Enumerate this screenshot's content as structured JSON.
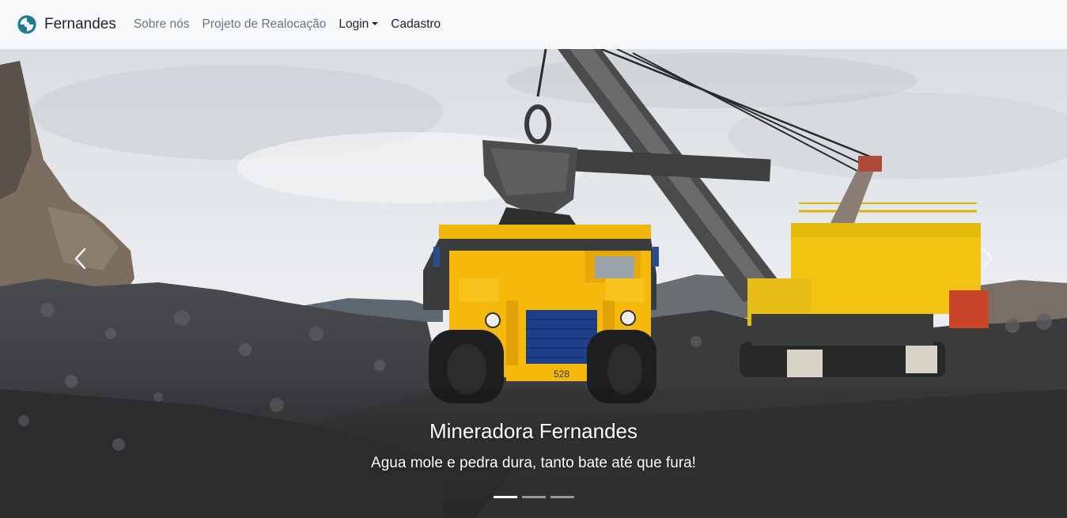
{
  "navbar": {
    "brand": "Fernandes",
    "links": [
      {
        "label": "Sobre nós"
      },
      {
        "label": "Projeto de Realocação"
      },
      {
        "label": "Login"
      },
      {
        "label": "Cadastro"
      }
    ]
  },
  "carousel": {
    "caption_title": "Mineradora Fernandes",
    "caption_text": "Agua mole e pedra dura, tanto bate até que fura!",
    "active_slide": 1,
    "slide_count": 3,
    "truck_number": "528"
  },
  "colors": {
    "navbar_bg": "#f8f9fa",
    "logo_teal": "#1e7b8a",
    "machine_yellow": "#f2c411",
    "truck_yellow": "#f5b90c"
  }
}
